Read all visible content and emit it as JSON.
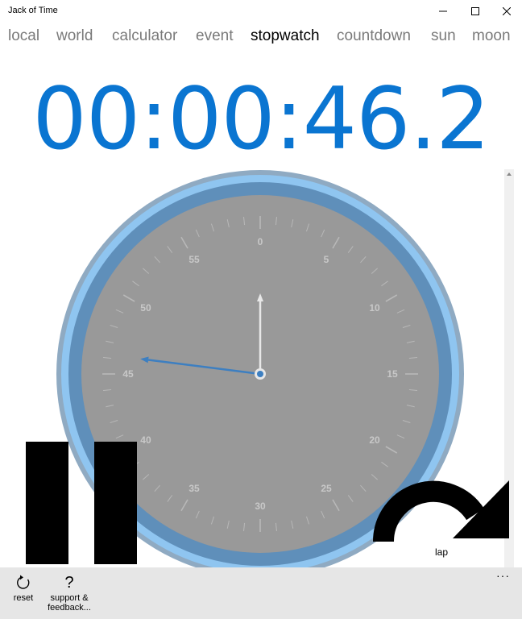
{
  "window": {
    "title": "Jack of Time",
    "minimize_icon": "minimize-icon",
    "maximize_icon": "maximize-icon",
    "close_icon": "close-icon"
  },
  "tabs": [
    {
      "label": "local",
      "active": false
    },
    {
      "label": "world",
      "active": false
    },
    {
      "label": "calculator",
      "active": false
    },
    {
      "label": "event",
      "active": false
    },
    {
      "label": "stopwatch",
      "active": true
    },
    {
      "label": "countdown",
      "active": false
    },
    {
      "label": "sun",
      "active": false
    },
    {
      "label": "moon",
      "active": false
    }
  ],
  "stopwatch": {
    "display": "00:00:46.2",
    "dial_numbers": [
      "0",
      "5",
      "10",
      "15",
      "20",
      "25",
      "30",
      "35",
      "40",
      "45",
      "50",
      "55"
    ],
    "seconds_hand_value": 46.2,
    "minutes_hand_value": 0,
    "lap_label": "lap",
    "pause_icon": "pause-icon",
    "lap_icon": "lap-arrow-icon"
  },
  "appbar": {
    "reset_label": "reset",
    "support_label_line1": "support &",
    "support_label_line2": "feedback...",
    "more_label": "···"
  },
  "colors": {
    "accent": "#0a75d1",
    "dial_face": "#999999",
    "outer_ring": "#8fc5f0",
    "inner_ring": "#5f8fba",
    "hand_blue": "#3d7fc1",
    "appbar_bg": "#e6e6e6"
  }
}
